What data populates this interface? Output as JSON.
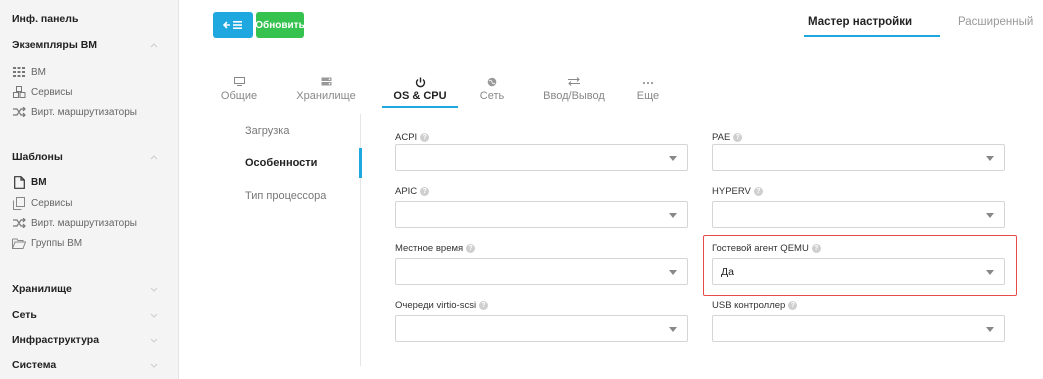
{
  "sidebar": {
    "dashboard": "Инф. панель",
    "instances": {
      "label": "Экземпляры ВМ",
      "items": [
        "ВМ",
        "Сервисы",
        "Вирт. маршрутизаторы"
      ]
    },
    "templates": {
      "label": "Шаблоны",
      "items": [
        "ВМ",
        "Сервисы",
        "Вирт. маршрутизаторы",
        "Группы ВМ"
      ]
    },
    "storage": "Хранилище",
    "network": "Сеть",
    "infrastructure": "Инфраструктура",
    "system": "Система"
  },
  "toolbar": {
    "refresh_label": "Обновить"
  },
  "modes": {
    "wizard": "Мастер настройки",
    "advanced": "Расширенный"
  },
  "tabs": [
    {
      "label": "Общие",
      "icon": "monitor-icon"
    },
    {
      "label": "Хранилище",
      "icon": "storage-icon"
    },
    {
      "label": "OS & CPU",
      "icon": "power-icon"
    },
    {
      "label": "Сеть",
      "icon": "globe-icon"
    },
    {
      "label": "Ввод/Вывод",
      "icon": "exchange-icon"
    },
    {
      "label": "Еще",
      "icon": "ellipsis-icon"
    }
  ],
  "subnav": [
    "Загрузка",
    "Особенности",
    "Тип процессора"
  ],
  "fields": {
    "acpi": {
      "label": "ACPI",
      "value": ""
    },
    "pae": {
      "label": "PAE",
      "value": ""
    },
    "apic": {
      "label": "APIC",
      "value": ""
    },
    "hyperv": {
      "label": "HYPERV",
      "value": ""
    },
    "localtime": {
      "label": "Местное время",
      "value": ""
    },
    "qemu_agent": {
      "label": "Гостевой агент QEMU",
      "value": "Да"
    },
    "virtio_scsi": {
      "label": "Очереди virtio-scsi",
      "value": ""
    },
    "usb": {
      "label": "USB контроллер",
      "value": ""
    }
  },
  "colors": {
    "accent": "#1fa8e0",
    "refresh": "#35c24f",
    "highlight": "#e84a4a"
  }
}
